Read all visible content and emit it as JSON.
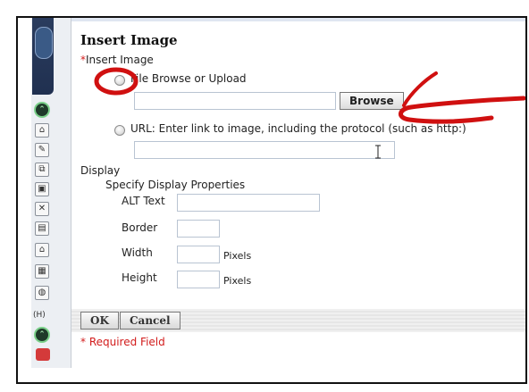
{
  "dialog": {
    "title": "Insert Image",
    "required_label": "Insert Image",
    "required_marker": "*",
    "option_file": "File Browse or Upload",
    "file_input_value": "",
    "browse_label": "Browse",
    "option_url": "URL: Enter link to image, including the protocol (such as http:)",
    "url_input_value": ""
  },
  "display": {
    "section_label": "Display",
    "subsection_label": "Specify Display Properties",
    "alt_label": "ALT Text",
    "alt_value": "",
    "border_label": "Border",
    "border_value": "",
    "width_label": "Width",
    "width_value": "",
    "width_unit": "Pixels",
    "height_label": "Height",
    "height_value": "",
    "height_unit": "Pixels"
  },
  "actions": {
    "ok_label": "OK",
    "cancel_label": "Cancel"
  },
  "footer": {
    "required_note": "* Required Field"
  },
  "toolbar": {
    "h_label": "(H)"
  },
  "colors": {
    "annotation_red": "#d01010",
    "required_red": "#d21b1b"
  },
  "icons": [
    "app-logo-icon",
    "expand-up-icon",
    "home-icon",
    "edit-icon",
    "copy-icon",
    "image-icon",
    "tools-icon",
    "document-icon",
    "home-outline-icon",
    "sitemap-icon",
    "globe-icon",
    "expand-down-icon",
    "trash-icon"
  ]
}
